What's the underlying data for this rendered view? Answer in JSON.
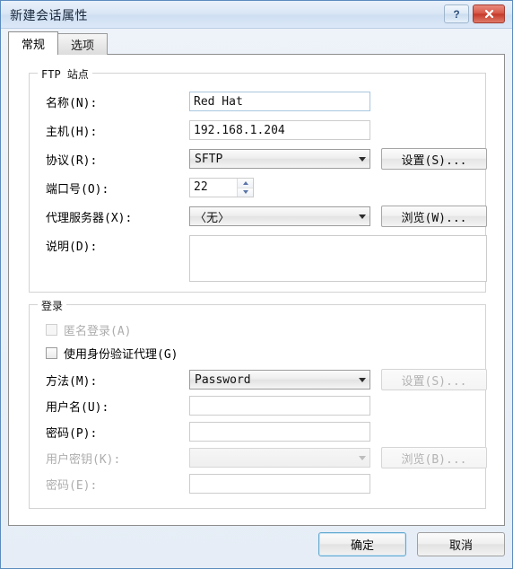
{
  "window": {
    "title": "新建会话属性",
    "help_button": "?",
    "close_button": "✕"
  },
  "tabs": [
    {
      "label": "常规",
      "active": true
    },
    {
      "label": "选项",
      "active": false
    }
  ],
  "ftp_site": {
    "group_title": "FTP 站点",
    "name_label": "名称(N):",
    "name_value": "Red Hat",
    "host_label": "主机(H):",
    "host_value": "192.168.1.204",
    "protocol_label": "协议(R):",
    "protocol_value": "SFTP",
    "protocol_settings_button": "设置(S)...",
    "port_label": "端口号(O):",
    "port_value": "22",
    "proxy_label": "代理服务器(X):",
    "proxy_value": "〈无〉",
    "proxy_browse_button": "浏览(W)...",
    "description_label": "说明(D):",
    "description_value": ""
  },
  "login": {
    "group_title": "登录",
    "anonymous_label": "匿名登录(A)",
    "anonymous_checked": false,
    "auth_agent_label": "使用身份验证代理(G)",
    "auth_agent_checked": false,
    "method_label": "方法(M):",
    "method_value": "Password",
    "method_settings_button": "设置(S)...",
    "username_label": "用户名(U):",
    "username_value": "",
    "password_label": "密码(P):",
    "password_value": "",
    "userkey_label": "用户密钥(K):",
    "userkey_value": "",
    "userkey_browse_button": "浏览(B)...",
    "passphrase_label": "密码(E):",
    "passphrase_value": ""
  },
  "footer": {
    "ok_button": "确定",
    "cancel_button": "取消"
  },
  "colors": {
    "title_bar": "#dbe7f6",
    "close_button": "#c53a2b",
    "focus_border": "#5fa8d0",
    "disabled_text": "#adadad"
  }
}
